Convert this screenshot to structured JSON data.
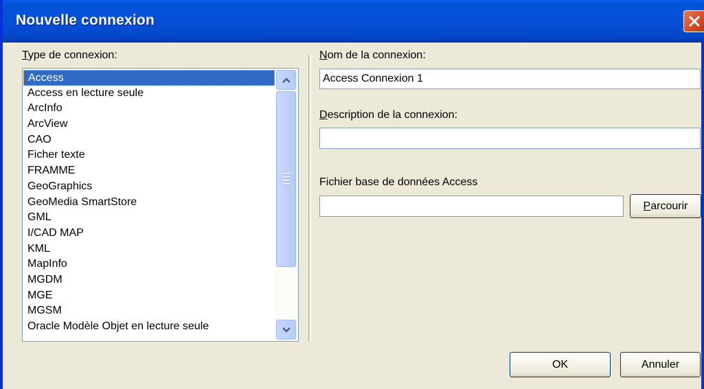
{
  "window": {
    "title": "Nouvelle connexion"
  },
  "connection_type": {
    "label": "Type de connexion:",
    "items": [
      "Access",
      "Access en lecture seule",
      "ArcInfo",
      "ArcView",
      "CAO",
      "Ficher texte",
      "FRAMME",
      "GeoGraphics",
      "GeoMedia SmartStore",
      "GML",
      "I/CAD MAP",
      "KML",
      "MapInfo",
      "MGDM",
      "MGE",
      "MGSM",
      "Oracle Modèle Objet en lecture seule"
    ],
    "selected": "Access"
  },
  "connection_name": {
    "label": "Nom de la connexion:",
    "value": "Access Connexion 1"
  },
  "connection_description": {
    "label": "Description de la connexion:",
    "value": ""
  },
  "database_file": {
    "label": "Fichier base de données Access",
    "value": "",
    "browse_label": "Parcourir"
  },
  "buttons": {
    "ok": "OK",
    "cancel": "Annuler"
  },
  "colors": {
    "titlebar": "#0550db",
    "selection": "#316ac5",
    "dialog_bg": "#ece9d8",
    "close_button": "#d6522c"
  }
}
